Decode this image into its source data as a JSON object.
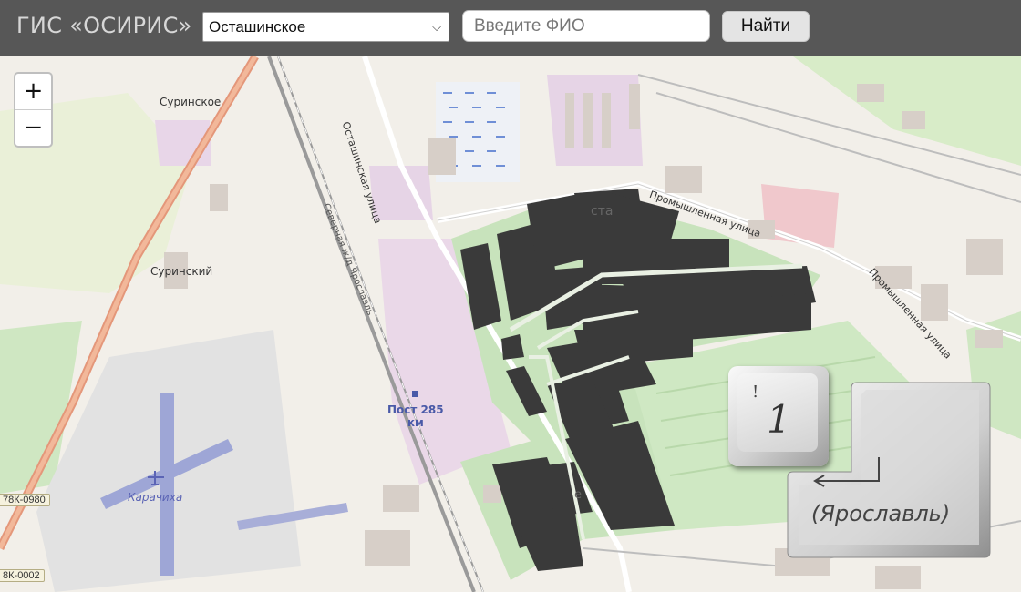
{
  "header": {
    "app_title": "ГИС «ОСИРИС»",
    "region_select": {
      "selected": "Осташинское"
    },
    "fio_input": {
      "placeholder": "Введите ФИО",
      "value": ""
    },
    "find_button": "Найти"
  },
  "map": {
    "zoom_in": "+",
    "zoom_out": "−",
    "labels": {
      "surinskoe": "Суринское",
      "surinsky": "Суринский",
      "ostashinskaya_street": "Осташинская улица",
      "promyshlennaya_street_1": "Промышленная улица",
      "promyshlennaya_street_2": "Промышленная улица",
      "post_285_line1": "Пост 285",
      "post_285_line2": "км",
      "karachikha": "Карачиха",
      "railway": "Северная ж/д Ярославль",
      "road_tag_1": "78К-0980",
      "road_tag_2": "8К-0002",
      "fragment_1": "ста",
      "fragment_2": "е"
    },
    "colors": {
      "background": "#f2efe9",
      "cemetery_plots": "#3a3a3a",
      "industrial": "#e9d9e7",
      "green": "#c8e3bc",
      "primary_road": "#f0a07a"
    }
  },
  "keycap": {
    "key_excl": "!",
    "key_num": "1",
    "enter_label": "(Ярославль)"
  }
}
